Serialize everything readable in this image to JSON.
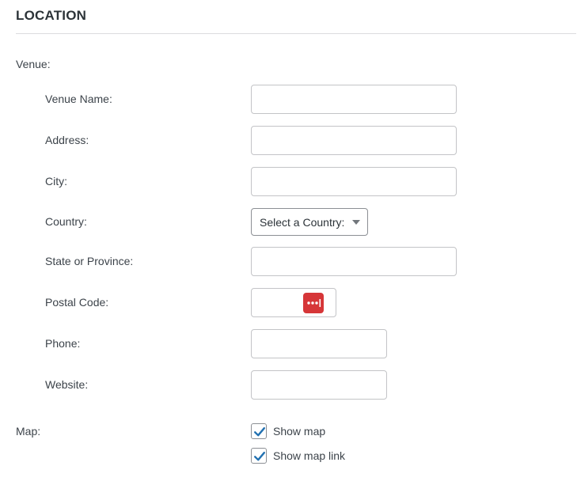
{
  "section": {
    "title": "LOCATION"
  },
  "venue": {
    "group_label": "Venue:",
    "fields": {
      "venue_name": {
        "label": "Venue Name:",
        "value": ""
      },
      "address": {
        "label": "Address:",
        "value": ""
      },
      "city": {
        "label": "City:",
        "value": ""
      },
      "country": {
        "label": "Country:",
        "selected": "Select a Country:"
      },
      "state": {
        "label": "State or Province:",
        "value": ""
      },
      "postal_code": {
        "label": "Postal Code:",
        "value": ""
      },
      "phone": {
        "label": "Phone:",
        "value": ""
      },
      "website": {
        "label": "Website:",
        "value": ""
      }
    }
  },
  "map": {
    "group_label": "Map:",
    "show_map": {
      "label": "Show map",
      "checked": true
    },
    "show_map_link": {
      "label": "Show map link",
      "checked": true
    }
  },
  "colors": {
    "accent": "#2271b1",
    "password_badge": "#d63638"
  },
  "icons": {
    "country_dropdown": "chevron-down-icon",
    "postal_code_badge": "password-manager-icon",
    "checkbox": "checkmark-icon"
  }
}
